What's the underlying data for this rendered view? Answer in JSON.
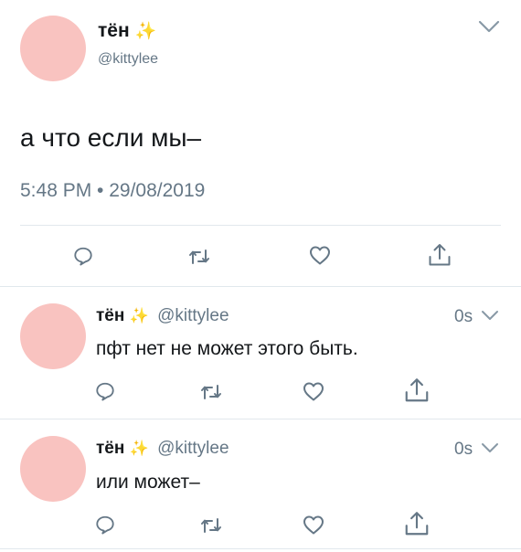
{
  "main_tweet": {
    "display_name": "тён",
    "sparkle": "✨",
    "handle": "@kittylee",
    "text": "а что если мы–",
    "timestamp": "5:48 PM • 29/08/2019"
  },
  "replies": [
    {
      "display_name": "тён",
      "sparkle": "✨",
      "handle": "@kittylee",
      "time": "0s",
      "text": "пфт нет не может этого быть."
    },
    {
      "display_name": "тён",
      "sparkle": "✨",
      "handle": "@kittylee",
      "time": "0s",
      "text": "или может–"
    }
  ],
  "icons": [
    "reply-icon",
    "retweet-icon",
    "like-icon",
    "share-icon",
    "chevron-down-icon"
  ],
  "colors": {
    "avatar": "#f9c3c0",
    "sparkle": "#f5c518",
    "text": "#14171a",
    "secondary": "#657786",
    "border": "#e1e8ed"
  }
}
